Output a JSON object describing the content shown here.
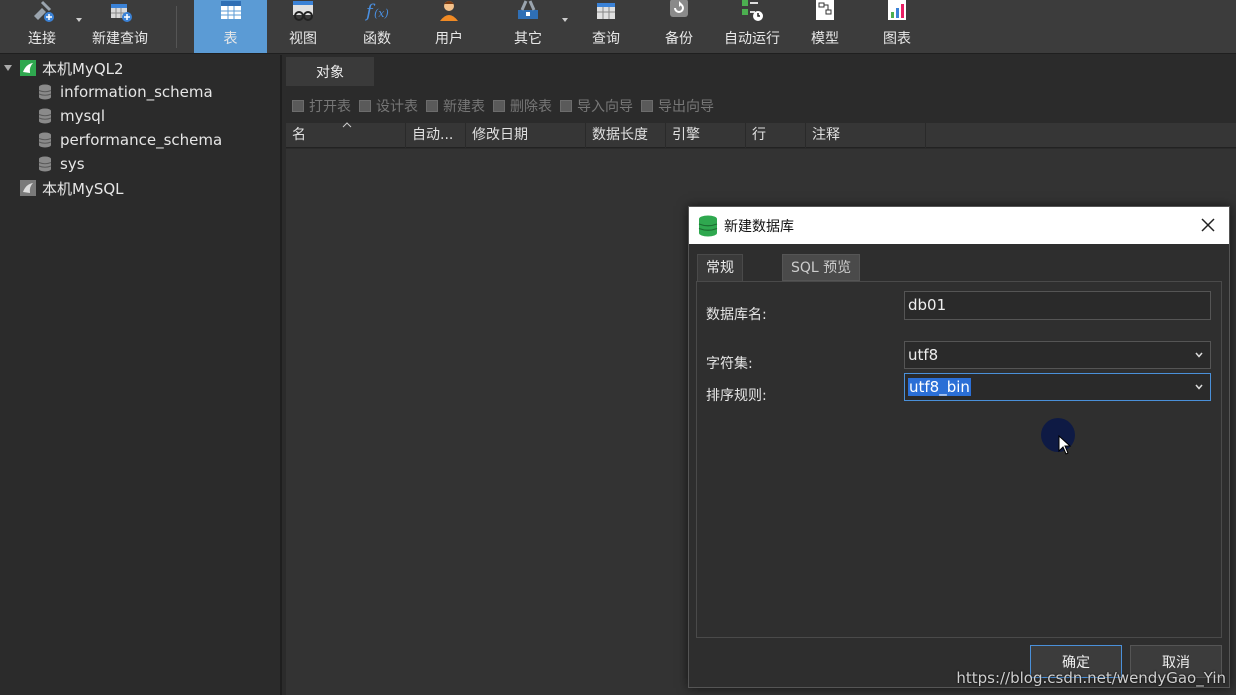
{
  "toolbar": {
    "items": [
      {
        "label": "连接",
        "icon": "connect-icon"
      },
      {
        "label": "新建查询",
        "icon": "new-query-icon"
      },
      {
        "label": "表",
        "icon": "table-icon",
        "active": true
      },
      {
        "label": "视图",
        "icon": "view-icon"
      },
      {
        "label": "函数",
        "icon": "function-icon"
      },
      {
        "label": "用户",
        "icon": "user-icon"
      },
      {
        "label": "其它",
        "icon": "other-icon"
      },
      {
        "label": "查询",
        "icon": "query-icon"
      },
      {
        "label": "备份",
        "icon": "backup-icon"
      },
      {
        "label": "自动运行",
        "icon": "auto-run-icon"
      },
      {
        "label": "模型",
        "icon": "model-icon"
      },
      {
        "label": "图表",
        "icon": "chart-icon"
      }
    ],
    "active_color": "#5b9bd5"
  },
  "tree": {
    "connections": [
      {
        "label": "本机MyQL2",
        "expanded": true,
        "databases": [
          "information_schema",
          "mysql",
          "performance_schema",
          "sys"
        ]
      },
      {
        "label": "本机MySQL",
        "expanded": false
      }
    ]
  },
  "objects": {
    "tab_label": "对象",
    "actions": [
      "打开表",
      "设计表",
      "新建表",
      "删除表",
      "导入向导",
      "导出向导"
    ],
    "columns": [
      "名",
      "自动...",
      "修改日期",
      "数据长度",
      "引擎",
      "行",
      "注释"
    ]
  },
  "dialog": {
    "title": "新建数据库",
    "tabs": [
      "常规",
      "SQL 预览"
    ],
    "fields": {
      "db_name_label": "数据库名:",
      "db_name_value": "db01",
      "charset_label": "字符集:",
      "charset_value": "utf8",
      "collation_label": "排序规则:",
      "collation_value": "utf8_bin"
    },
    "ok_label": "确定",
    "cancel_label": "取消"
  },
  "watermark": "https://blog.csdn.net/wendyGao_Yin"
}
